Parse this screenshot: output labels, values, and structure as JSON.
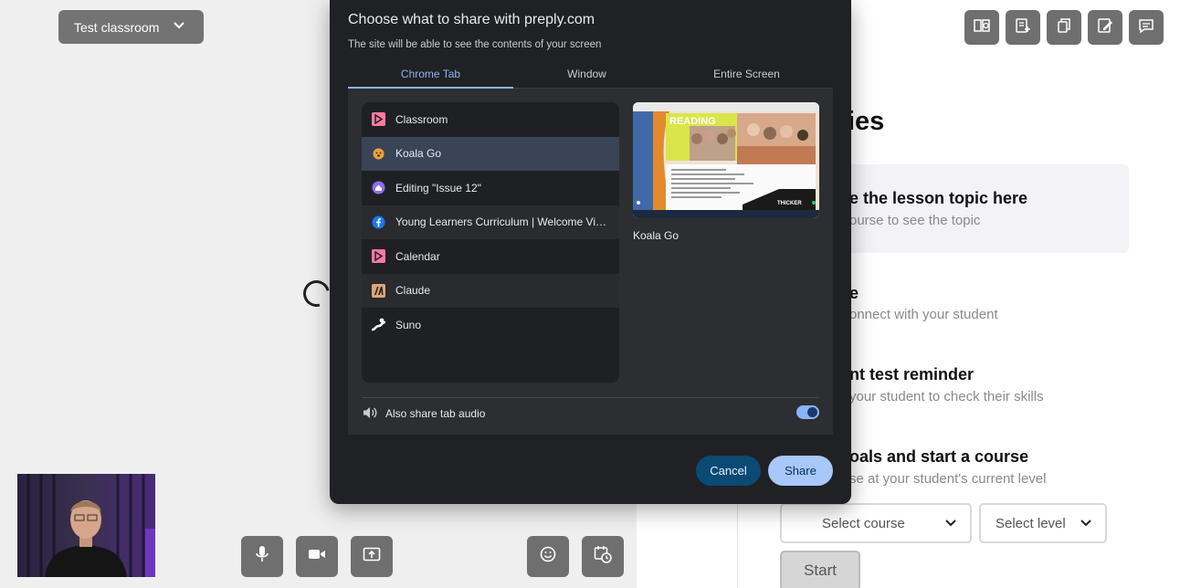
{
  "app": {
    "classroom_select": "Test classroom",
    "heading_partial": "ies",
    "topic_card": {
      "title": "e the lesson topic here",
      "subtitle": "ourse to see the topic"
    },
    "sections": [
      {
        "title": "e",
        "subtitle": "onnect with your student"
      },
      {
        "title": "nt test reminder",
        "subtitle": "your student to check their skills"
      },
      {
        "title": "oals and start a course",
        "subtitle": "se at your student's current level"
      }
    ],
    "course_select": "Select course",
    "level_select": "Select level",
    "start_button": "Start",
    "controls": [
      "mic-icon",
      "camera-icon",
      "screen-share-icon",
      "emoji-icon",
      "schedule-icon"
    ],
    "top_tools": [
      "book-icon",
      "add-note-icon",
      "copy-icon",
      "edit-icon",
      "chat-icon"
    ]
  },
  "dialog": {
    "title": "Choose what to share with preply.com",
    "subtitle": "The site will be able to see the contents of your screen",
    "tabs": [
      {
        "label": "Chrome Tab",
        "active": true
      },
      {
        "label": "Window",
        "active": false
      },
      {
        "label": "Entire Screen",
        "active": false
      }
    ],
    "tab_rows": [
      {
        "label": "Classroom",
        "icon": "preply-icon",
        "state": "normal"
      },
      {
        "label": "Koala Go",
        "icon": "koala-icon",
        "state": "selected"
      },
      {
        "label": "Editing \"Issue 12\"",
        "icon": "purple-home-icon",
        "state": "normal"
      },
      {
        "label": "Young Learners Curriculum | Welcome Vid...",
        "icon": "facebook-icon",
        "state": "alt"
      },
      {
        "label": "Calendar",
        "icon": "preply-icon",
        "state": "normal"
      },
      {
        "label": "Claude",
        "icon": "claude-icon",
        "state": "alt"
      },
      {
        "label": "Suno",
        "icon": "suno-icon",
        "state": "normal"
      }
    ],
    "preview_label": "Koala Go",
    "preview_text": "READING",
    "audio_label": "Also share tab audio",
    "audio_enabled": true,
    "cancel_label": "Cancel",
    "share_label": "Share"
  },
  "colors": {
    "dialog_bg": "#202124",
    "accent": "#8ab4f8",
    "share_button": "#a8c7fa",
    "cancel_button": "#0b4a73"
  }
}
